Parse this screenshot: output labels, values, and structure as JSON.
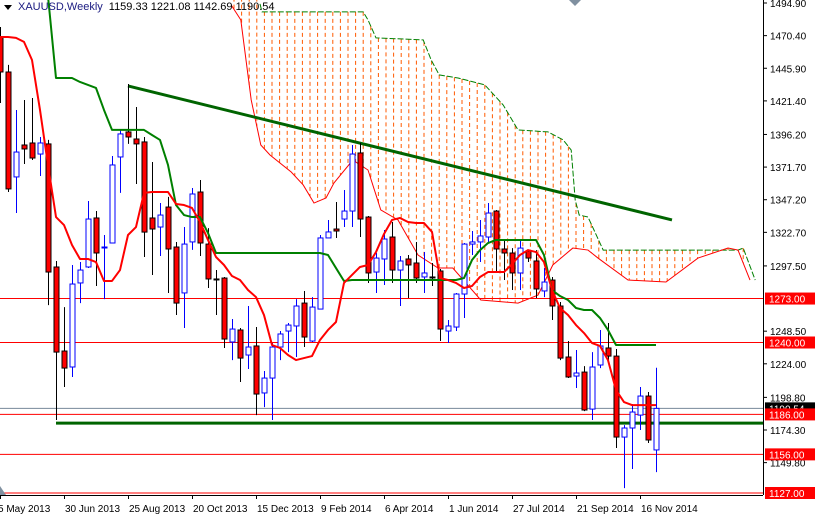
{
  "header": {
    "symbol": "XAUUSD,Weekly",
    "ohlc": "1159.33 1221.08 1142.69 1190.54",
    "menu_icon": "triangle-down-icon"
  },
  "colors": {
    "bull": "#0000ff",
    "bear": "#ff0000",
    "tenkan": "#ff0000",
    "kijun": "#008000",
    "cloud": "#ff5a00",
    "trendline": "#006400",
    "level": "#ff0000",
    "bid": "#778899"
  },
  "chart_data": {
    "type": "candlestick",
    "title": "XAUUSD,Weekly",
    "timeframe": "Weekly",
    "ylim": [
      1127.0,
      1494.9
    ],
    "y_ticks": [
      "1494.90",
      "1470.40",
      "1445.90",
      "1421.40",
      "1396.20",
      "1371.70",
      "1347.20",
      "1322.70",
      "1297.50",
      "1248.50",
      "1224.00",
      "1198.80",
      "1174.30",
      "1149.80"
    ],
    "x_labels": [
      {
        "week": 0,
        "label": "5 May 2013"
      },
      {
        "week": 8,
        "label": "30 Jun 2013"
      },
      {
        "week": 16,
        "label": "25 Aug 2013"
      },
      {
        "week": 24,
        "label": "20 Oct 2013"
      },
      {
        "week": 32,
        "label": "15 Dec 2013"
      },
      {
        "week": 40,
        "label": "9 Feb 2014"
      },
      {
        "week": 48,
        "label": "6 Apr 2014"
      },
      {
        "week": 56,
        "label": "1 Jun 2014"
      },
      {
        "week": 64,
        "label": "27 Jul 2014"
      },
      {
        "week": 72,
        "label": "21 Sep 2014"
      },
      {
        "week": 80,
        "label": "16 Nov 2014"
      }
    ],
    "candles_ohlc": [
      [
        1469.4,
        1476.9,
        1419.8,
        1443.1
      ],
      [
        1443.1,
        1448.4,
        1353.0,
        1355.3
      ],
      [
        1364.3,
        1414.6,
        1337.2,
        1383.0
      ],
      [
        1388.3,
        1422.1,
        1374.0,
        1385.3
      ],
      [
        1389.8,
        1423.6,
        1377.0,
        1378.5
      ],
      [
        1381.5,
        1394.3,
        1365.0,
        1389.8
      ],
      [
        1389.1,
        1392.1,
        1268.1,
        1292.9
      ],
      [
        1296.7,
        1301.2,
        1181.8,
        1232.8
      ],
      [
        1233.6,
        1266.6,
        1206.6,
        1220.8
      ],
      [
        1221.6,
        1298.2,
        1214.1,
        1283.9
      ],
      [
        1284.7,
        1300.4,
        1269.6,
        1294.4
      ],
      [
        1296.7,
        1346.2,
        1295.9,
        1332.7
      ],
      [
        1333.5,
        1338.7,
        1282.4,
        1307.2
      ],
      [
        1311.3,
        1320.7,
        1272.6,
        1311.7
      ],
      [
        1314.7,
        1380.0,
        1314.7,
        1373.3
      ],
      [
        1379.3,
        1399.6,
        1352.3,
        1396.6
      ],
      [
        1398.1,
        1434.1,
        1389.1,
        1394.3
      ],
      [
        1392.8,
        1416.8,
        1359.0,
        1389.1
      ],
      [
        1390.6,
        1394.3,
        1304.2,
        1322.9
      ],
      [
        1333.5,
        1375.5,
        1290.7,
        1325.2
      ],
      [
        1326.7,
        1344.7,
        1304.9,
        1335.7
      ],
      [
        1341.7,
        1349.3,
        1277.2,
        1310.2
      ],
      [
        1311.7,
        1315.5,
        1260.6,
        1269.6
      ],
      [
        1277.2,
        1326.7,
        1250.9,
        1313.9
      ],
      [
        1315.5,
        1356.0,
        1309.5,
        1351.5
      ],
      [
        1353.0,
        1362.0,
        1304.9,
        1314.7
      ],
      [
        1313.9,
        1325.9,
        1280.9,
        1287.7
      ],
      [
        1287.7,
        1294.4,
        1260.6,
        1287.2
      ],
      [
        1288.4,
        1289.2,
        1235.9,
        1242.6
      ],
      [
        1240.4,
        1257.6,
        1226.8,
        1250.1
      ],
      [
        1249.4,
        1250.9,
        1210.3,
        1228.3
      ],
      [
        1230.6,
        1267.4,
        1220.1,
        1236.6
      ],
      [
        1237.4,
        1251.6,
        1185.5,
        1201.3
      ],
      [
        1202.1,
        1218.6,
        1191.5,
        1213.3
      ],
      [
        1213.3,
        1239.6,
        1181.8,
        1236.6
      ],
      [
        1236.6,
        1248.6,
        1226.8,
        1246.4
      ],
      [
        1248.6,
        1254.6,
        1232.8,
        1253.1
      ],
      [
        1252.4,
        1272.6,
        1229.1,
        1267.4
      ],
      [
        1269.6,
        1278.7,
        1236.6,
        1244.1
      ],
      [
        1241.1,
        1274.1,
        1240.4,
        1266.6
      ],
      [
        1265.1,
        1320.7,
        1265.1,
        1318.5
      ],
      [
        1318.5,
        1332.0,
        1318.5,
        1323.0
      ],
      [
        1325.2,
        1345.5,
        1318.5,
        1323.7
      ],
      [
        1332.7,
        1354.5,
        1326.7,
        1338.7
      ],
      [
        1338.7,
        1388.3,
        1326.7,
        1381.5
      ],
      [
        1382.3,
        1389.8,
        1319.2,
        1332.7
      ],
      [
        1334.2,
        1335.0,
        1284.7,
        1292.2
      ],
      [
        1292.9,
        1307.2,
        1277.2,
        1303.4
      ],
      [
        1302.7,
        1324.5,
        1283.2,
        1317.7
      ],
      [
        1319.2,
        1330.5,
        1284.7,
        1294.4
      ],
      [
        1294.4,
        1304.9,
        1267.4,
        1301.2
      ],
      [
        1302.7,
        1305.7,
        1273.4,
        1298.2
      ],
      [
        1299.7,
        1315.5,
        1284.7,
        1288.4
      ],
      [
        1289.2,
        1307.9,
        1277.2,
        1292.2
      ],
      [
        1289.2,
        1299.7,
        1282.4,
        1289.0
      ],
      [
        1293.7,
        1295.2,
        1241.1,
        1250.1
      ],
      [
        1248.6,
        1256.9,
        1239.6,
        1252.4
      ],
      [
        1251.6,
        1277.2,
        1248.6,
        1276.4
      ],
      [
        1276.4,
        1314.7,
        1258.4,
        1313.9
      ],
      [
        1313.9,
        1323.7,
        1305.7,
        1315.5
      ],
      [
        1315.5,
        1332.0,
        1300.4,
        1320.0
      ],
      [
        1319.2,
        1344.7,
        1314.7,
        1337.2
      ],
      [
        1338.7,
        1339.5,
        1292.2,
        1310.2
      ],
      [
        1310.2,
        1317.0,
        1286.9,
        1307.2
      ],
      [
        1307.2,
        1310.9,
        1279.4,
        1292.2
      ],
      [
        1292.2,
        1317.0,
        1279.4,
        1310.9
      ],
      [
        1308.7,
        1309.4,
        1300.4,
        1303.4
      ],
      [
        1301.2,
        1309.4,
        1273.4,
        1280.2
      ],
      [
        1278.7,
        1295.9,
        1274.1,
        1285.4
      ],
      [
        1286.9,
        1289.2,
        1256.9,
        1267.4
      ],
      [
        1267.4,
        1270.4,
        1226.8,
        1228.3
      ],
      [
        1229.1,
        1241.1,
        1213.3,
        1214.1
      ],
      [
        1214.8,
        1234.4,
        1205.8,
        1217.1
      ],
      [
        1217.8,
        1222.3,
        1188.5,
        1189.3
      ],
      [
        1190.0,
        1232.8,
        1181.8,
        1221.6
      ],
      [
        1223.1,
        1249.4,
        1220.8,
        1237.4
      ],
      [
        1235.9,
        1254.6,
        1224.6,
        1229.8
      ],
      [
        1229.8,
        1235.1,
        1160.8,
        1169.0
      ],
      [
        1169.0,
        1178.0,
        1130.7,
        1175.8
      ],
      [
        1175.8,
        1193.8,
        1145.0,
        1187.8
      ],
      [
        1185.5,
        1206.6,
        1174.3,
        1199.8
      ],
      [
        1199.8,
        1202.8,
        1164.5,
        1166.8
      ],
      [
        1159.33,
        1221.08,
        1142.69,
        1190.54
      ]
    ],
    "tenkan_sen": [
      1469.4,
      1469.4,
      1468.7,
      1465.7,
      1452.1,
      1414.6,
      1373.3,
      1334.2,
      1328.2,
      1313.2,
      1302.7,
      1302.7,
      1300.4,
      1286.2,
      1286.2,
      1294.4,
      1320.7,
      1326.7,
      1352.3,
      1353.0,
      1353.0,
      1353.0,
      1344.0,
      1343.2,
      1341.0,
      1330.5,
      1317.0,
      1304.2,
      1298.2,
      1289.9,
      1286.9,
      1279.4,
      1274.1,
      1260.6,
      1238.1,
      1235.9,
      1230.6,
      1226.8,
      1228.3,
      1229.8,
      1241.9,
      1249.4,
      1255.4,
      1284.7,
      1290.7,
      1296.7,
      1298.2,
      1307.9,
      1321.5,
      1332.0,
      1333.5,
      1330.5,
      1329.7,
      1329.7,
      1323.0,
      1288.4,
      1286.9,
      1284.7,
      1280.9,
      1282.4,
      1289.2,
      1292.9,
      1292.9,
      1292.9,
      1298.9,
      1305.7,
      1309.4,
      1307.9,
      1300.4,
      1279.4,
      1265.9,
      1260.6,
      1253.1,
      1247.1,
      1239.6,
      1237.4,
      1226.8,
      1204.3,
      1195.3,
      1193.0,
      1193.0,
      1193.0,
      1193.0
    ],
    "kijun_sen": [
      null,
      null,
      null,
      null,
      null,
      null,
      1500.0,
      1438.6,
      1438.6,
      1438.6,
      1435.6,
      1433.4,
      1431.1,
      1414.6,
      1399.6,
      1399.6,
      1399.6,
      1399.6,
      1399.6,
      1395.8,
      1392.1,
      1373.3,
      1343.2,
      1335.7,
      1334.2,
      1334.2,
      1322.2,
      1307.2,
      1307.2,
      1307.2,
      1307.2,
      1307.2,
      1307.2,
      1307.2,
      1307.2,
      1307.2,
      1307.2,
      1307.2,
      1307.2,
      1307.2,
      1307.2,
      1305.7,
      1295.9,
      1286.2,
      1286.9,
      1286.9,
      1286.9,
      1286.9,
      1286.9,
      1286.9,
      1286.9,
      1286.9,
      1286.9,
      1286.9,
      1286.9,
      1286.9,
      1286.9,
      1286.9,
      1288.4,
      1301.9,
      1309.4,
      1314.7,
      1317.0,
      1317.0,
      1317.0,
      1317.0,
      1317.0,
      1317.0,
      1305.7,
      1279.4,
      1274.9,
      1271.9,
      1265.9,
      1264.4,
      1264.4,
      1258.4,
      1249.4,
      1238.1,
      1238.1,
      1238.1,
      1238.1,
      1238.1,
      1238.1
    ],
    "cloud_upper": [
      [
        32.5,
        1494.2
      ],
      [
        32.75,
        1488.2
      ],
      [
        45.4,
        1488.2
      ],
      [
        46,
        1482.2
      ],
      [
        47,
        1468.7
      ],
      [
        52.9,
        1467.2
      ],
      [
        53.9,
        1452.1
      ],
      [
        54.9,
        1440.9
      ],
      [
        57.25,
        1438.6
      ],
      [
        60.6,
        1433.4
      ],
      [
        62.9,
        1418.3
      ],
      [
        64.75,
        1399.6
      ],
      [
        68.5,
        1398.1
      ],
      [
        70.4,
        1392.1
      ],
      [
        71.4,
        1384.5
      ],
      [
        71.9,
        1347.0
      ],
      [
        72.4,
        1335.7
      ],
      [
        73.5,
        1334.2
      ],
      [
        75.4,
        1309.4
      ],
      [
        92.25,
        1309.4
      ],
      [
        92.9,
        1310.9
      ],
      [
        94.4,
        1286.9
      ]
    ],
    "cloud_lower": [
      [
        28.9,
        1493.4
      ],
      [
        30.1,
        1482.2
      ],
      [
        31.4,
        1422.1
      ],
      [
        32.6,
        1388.3
      ],
      [
        33.75,
        1380.8
      ],
      [
        36.4,
        1368.0
      ],
      [
        37.9,
        1358.3
      ],
      [
        39.25,
        1344.7
      ],
      [
        40.75,
        1348.5
      ],
      [
        41.75,
        1359.8
      ],
      [
        44.1,
        1377.0
      ],
      [
        46,
        1369.5
      ],
      [
        47,
        1350.8
      ],
      [
        47.6,
        1339.5
      ],
      [
        49.75,
        1332.0
      ],
      [
        52.25,
        1305.7
      ],
      [
        54.75,
        1295.9
      ],
      [
        56.6,
        1295.9
      ],
      [
        60.1,
        1271.9
      ],
      [
        64.75,
        1269.6
      ],
      [
        67.25,
        1275.6
      ],
      [
        69.1,
        1298.2
      ],
      [
        71.6,
        1310.9
      ],
      [
        73.5,
        1309.4
      ],
      [
        74.75,
        1303.4
      ],
      [
        78.5,
        1286.9
      ],
      [
        83.25,
        1285.4
      ],
      [
        87.25,
        1303.4
      ],
      [
        91,
        1310.9
      ],
      [
        92.25,
        1309.4
      ],
      [
        93.75,
        1286.9
      ]
    ],
    "trendline": [
      [
        16,
        1432.6
      ],
      [
        84,
        1332.0
      ]
    ],
    "support_line": {
      "from_week": 7,
      "price": 1179.5
    },
    "levels": [
      {
        "label": "1273.00",
        "price": 1273.0
      },
      {
        "label": "1240.00",
        "price": 1240.0
      },
      {
        "label": "1186.00",
        "price": 1186.0
      },
      {
        "label": "1156.00",
        "price": 1156.0
      },
      {
        "label": "1127.00",
        "price": 1127.0
      }
    ],
    "bid": {
      "label": "1190.54",
      "price": 1190.54
    }
  }
}
